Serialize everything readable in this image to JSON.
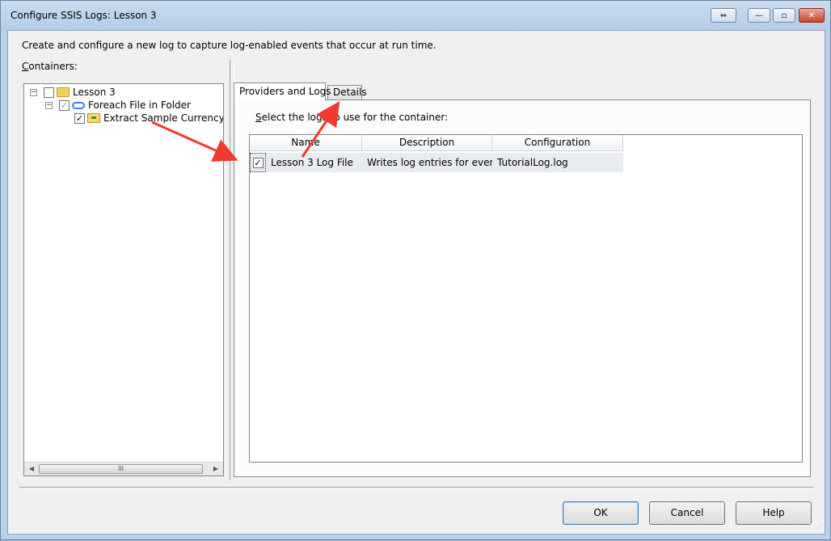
{
  "window": {
    "title": "Configure SSIS Logs: Lesson 3",
    "buttons": {
      "restore": "⇔",
      "minimize": "—",
      "maximize": "▫",
      "close": "✕"
    }
  },
  "description": "Create and configure a new log to capture log-enabled events that occur at run time.",
  "containers": {
    "label_prefix": "C",
    "label_rest": "ontainers:",
    "tree": [
      {
        "label": "Lesson 3",
        "expander": "−",
        "checked": "",
        "icon": "folder-icon"
      },
      {
        "label": "Foreach File in Folder",
        "expander": "−",
        "checked": "✓",
        "icon": "loop-icon"
      },
      {
        "label": "Extract Sample Currency Data",
        "checked": "✓",
        "icon": "data-flow-icon"
      }
    ],
    "scrollbar": {
      "left": "◀",
      "right": "▶",
      "thumb": "III"
    }
  },
  "tabs": [
    {
      "label": "Providers and Logs"
    },
    {
      "label": "Details"
    }
  ],
  "providers": {
    "label_prefix": "S",
    "label_rest": "elect the logs to use for the container:",
    "columns": [
      "Name",
      "Description",
      "Configuration"
    ],
    "rows": [
      {
        "checked": "✓",
        "name": "Lesson 3 Log File",
        "description": "Writes log entries for even...",
        "configuration": "TutorialLog.log"
      }
    ]
  },
  "buttons": {
    "ok": "OK",
    "cancel": "Cancel",
    "help": "Help"
  },
  "annotation_color": "#f03a30"
}
